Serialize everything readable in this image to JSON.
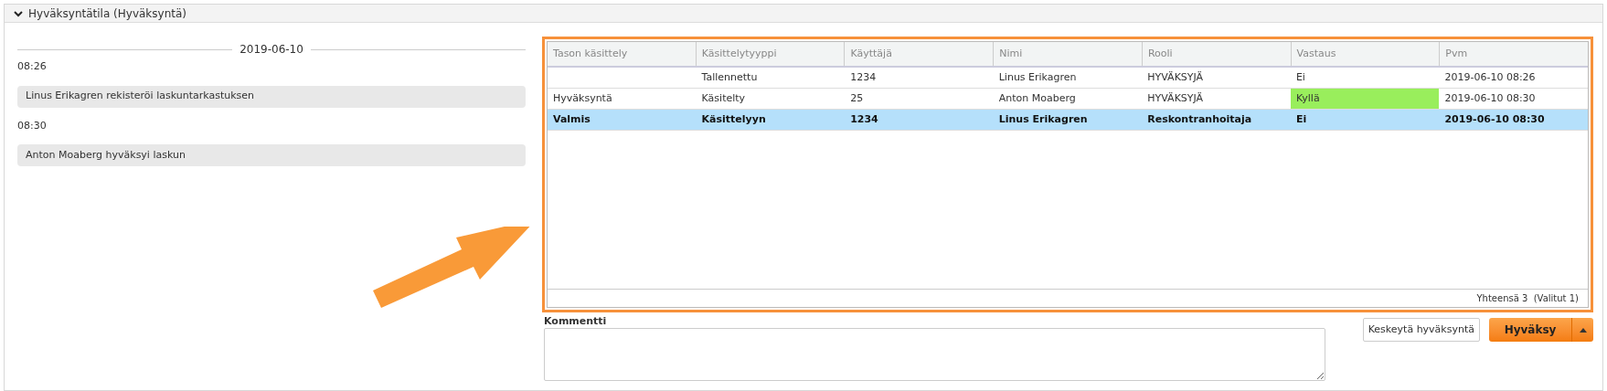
{
  "panel": {
    "title": "Hyväksyntätila (Hyväksyntä)",
    "expanded": true
  },
  "timeline": {
    "date": "2019-06-10",
    "events": [
      {
        "time": "08:26",
        "text": "Linus Erikagren rekisteröi laskuntarkastuksen"
      },
      {
        "time": "08:30",
        "text": "Anton Moaberg hyväksyi laskun"
      }
    ]
  },
  "table": {
    "columns": [
      "Tason käsittely",
      "Käsittelytyyppi",
      "Käyttäjä",
      "Nimi",
      "Rooli",
      "Vastaus",
      "Pvm"
    ],
    "rows": [
      {
        "selected": false,
        "cells": [
          null,
          {
            "text": "Tallennettu"
          },
          {
            "text": "1234"
          },
          {
            "text": "Linus Erikagren"
          },
          {
            "text": "HYVÄKSYJÄ"
          },
          {
            "text": "Ei"
          },
          {
            "text": "2019-06-10 08:26"
          }
        ]
      },
      {
        "selected": false,
        "cells": [
          {
            "text": "Hyväksyntä"
          },
          {
            "text": "Käsitelty"
          },
          {
            "text": "25"
          },
          {
            "text": "Anton Moaberg"
          },
          {
            "text": "HYVÄKSYJÄ"
          },
          {
            "text": "Kyllä",
            "color": "#99ee5c"
          },
          {
            "text": "2019-06-10 08:30"
          }
        ]
      },
      {
        "selected": true,
        "cells": [
          {
            "text": "Valmis"
          },
          {
            "text": "Käsittelyyn"
          },
          {
            "text": "1234"
          },
          {
            "text": "Linus Erikagren"
          },
          {
            "text": "Reskontranhoitaja"
          },
          {
            "text": "Ei"
          },
          {
            "text": "2019-06-10 08:30"
          }
        ]
      }
    ],
    "footer": "Yhteensä 3  (Valitut 1)"
  },
  "comment": {
    "label": "Kommentti"
  },
  "buttons": {
    "cancel": "Keskeytä hyväksyntä",
    "approve": "Hyväksy"
  }
}
